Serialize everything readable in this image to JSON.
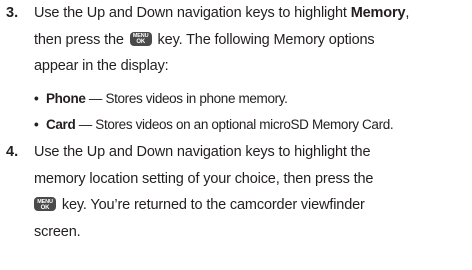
{
  "step3": {
    "number": "3.",
    "line1_a": "Use the Up and Down navigation keys to highlight ",
    "line1_bold": "Memory",
    "line1_b": ",",
    "line2_a": "then press the ",
    "key_top": "MENU",
    "key_bottom": "OK",
    "line2_b": " key. The following Memory options",
    "line3": "appear in the display:"
  },
  "bullets": [
    {
      "dot": "•",
      "term": "Phone",
      "desc": " — Stores videos in phone memory."
    },
    {
      "dot": "•",
      "term": "Card",
      "desc": " — Stores videos on an optional microSD Memory Card."
    }
  ],
  "step4": {
    "number": "4.",
    "line1": "Use the Up and Down navigation keys to highlight the",
    "line2": "memory location setting of your choice, then press the",
    "line3_b": " key. You’re returned to the camcorder viewfinder",
    "line4": "screen."
  }
}
